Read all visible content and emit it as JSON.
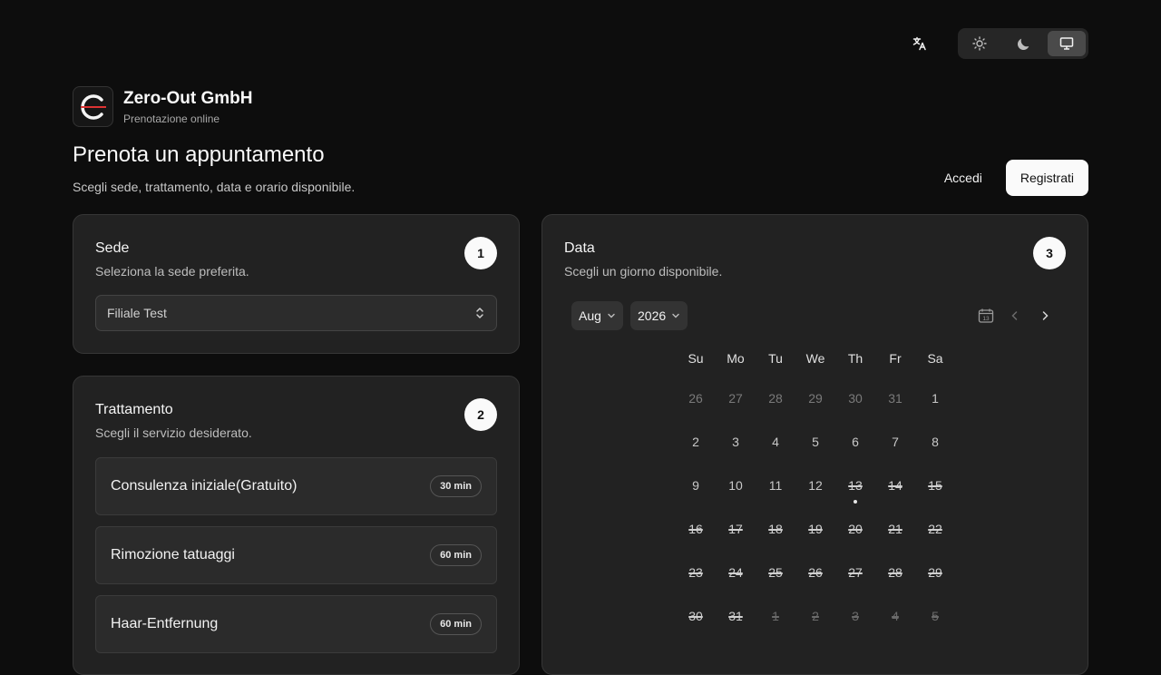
{
  "header": {
    "lang_icon": "translate-icon",
    "theme_options": [
      {
        "name": "light",
        "icon": "sun-icon",
        "active": false
      },
      {
        "name": "dark",
        "icon": "moon-icon",
        "active": false
      },
      {
        "name": "system",
        "icon": "monitor-icon",
        "active": true
      }
    ]
  },
  "brand": {
    "name": "Zero-Out GmbH",
    "subtitle": "Prenotazione online"
  },
  "page": {
    "title": "Prenota un appuntamento",
    "subtitle": "Scegli sede, trattamento, data e orario disponibile."
  },
  "auth": {
    "login_label": "Accedi",
    "register_label": "Registrati"
  },
  "location": {
    "title": "Sede",
    "subtitle": "Seleziona la sede preferita.",
    "step": "1",
    "selected": "Filiale Test"
  },
  "treatment": {
    "title": "Trattamento",
    "subtitle": "Scegli il servizio desiderato.",
    "step": "2",
    "services": [
      {
        "name": "Consulenza iniziale(Gratuito)",
        "duration": "30 min"
      },
      {
        "name": "Rimozione tatuaggi",
        "duration": "60 min"
      },
      {
        "name": "Haar-Entfernung",
        "duration": "60 min"
      }
    ]
  },
  "date": {
    "title": "Data",
    "subtitle": "Scegli un giorno disponibile.",
    "step": "3",
    "month": "Aug",
    "year": "2026",
    "today_icon_label": "13",
    "weekdays": [
      "Su",
      "Mo",
      "Tu",
      "We",
      "Th",
      "Fr",
      "Sa"
    ],
    "weeks": [
      [
        {
          "d": "26",
          "s": "outside"
        },
        {
          "d": "27",
          "s": "outside"
        },
        {
          "d": "28",
          "s": "outside"
        },
        {
          "d": "29",
          "s": "outside"
        },
        {
          "d": "30",
          "s": "outside"
        },
        {
          "d": "31",
          "s": "outside"
        },
        {
          "d": "1",
          "s": "avail"
        }
      ],
      [
        {
          "d": "2",
          "s": "avail"
        },
        {
          "d": "3",
          "s": "avail"
        },
        {
          "d": "4",
          "s": "avail"
        },
        {
          "d": "5",
          "s": "avail"
        },
        {
          "d": "6",
          "s": "avail"
        },
        {
          "d": "7",
          "s": "avail"
        },
        {
          "d": "8",
          "s": "avail"
        }
      ],
      [
        {
          "d": "9",
          "s": "avail"
        },
        {
          "d": "10",
          "s": "avail"
        },
        {
          "d": "11",
          "s": "avail"
        },
        {
          "d": "12",
          "s": "avail"
        },
        {
          "d": "13",
          "s": "struck",
          "today": true
        },
        {
          "d": "14",
          "s": "struck"
        },
        {
          "d": "15",
          "s": "struck"
        }
      ],
      [
        {
          "d": "16",
          "s": "struck"
        },
        {
          "d": "17",
          "s": "struck"
        },
        {
          "d": "18",
          "s": "struck"
        },
        {
          "d": "19",
          "s": "struck"
        },
        {
          "d": "20",
          "s": "struck"
        },
        {
          "d": "21",
          "s": "struck"
        },
        {
          "d": "22",
          "s": "struck"
        }
      ],
      [
        {
          "d": "23",
          "s": "struck"
        },
        {
          "d": "24",
          "s": "struck"
        },
        {
          "d": "25",
          "s": "struck"
        },
        {
          "d": "26",
          "s": "struck"
        },
        {
          "d": "27",
          "s": "struck"
        },
        {
          "d": "28",
          "s": "struck"
        },
        {
          "d": "29",
          "s": "struck"
        }
      ],
      [
        {
          "d": "30",
          "s": "struck"
        },
        {
          "d": "31",
          "s": "struck"
        },
        {
          "d": "1",
          "s": "struck outside"
        },
        {
          "d": "2",
          "s": "struck outside"
        },
        {
          "d": "3",
          "s": "struck outside"
        },
        {
          "d": "4",
          "s": "struck outside"
        },
        {
          "d": "5",
          "s": "struck outside"
        }
      ]
    ]
  }
}
